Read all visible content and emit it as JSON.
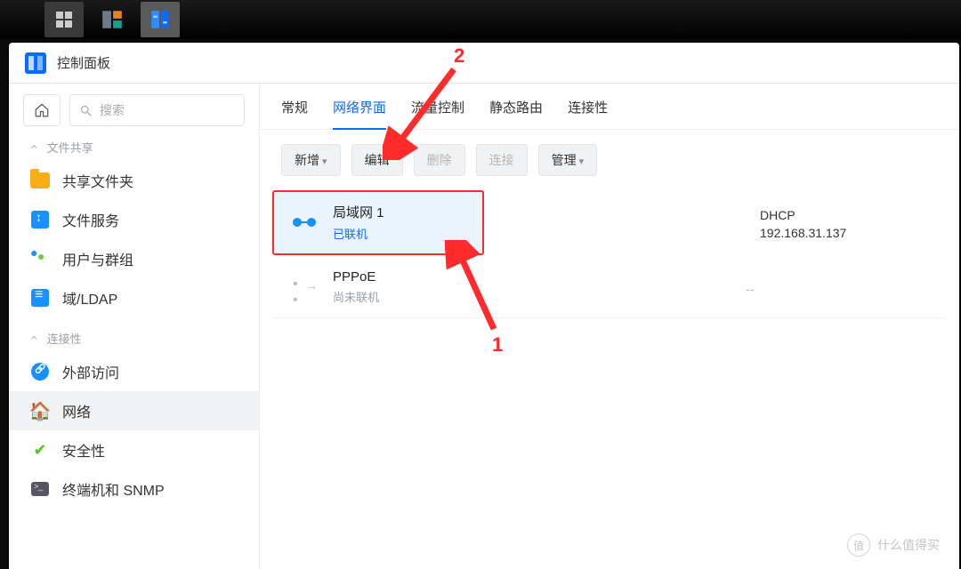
{
  "taskbar": {
    "apps_label": "Applications"
  },
  "window": {
    "title": "控制面板"
  },
  "sidebar": {
    "search_placeholder": "搜索",
    "sections": {
      "file_share": "文件共享",
      "connectivity": "连接性"
    },
    "items": {
      "shared_folder": "共享文件夹",
      "file_services": "文件服务",
      "users_groups": "用户与群组",
      "domain_ldap": "域/LDAP",
      "external_access": "外部访问",
      "network": "网络",
      "security": "安全性",
      "terminal_snmp": "终端机和 SNMP"
    }
  },
  "tabs": {
    "general": "常规",
    "network_interface": "网络界面",
    "traffic": "流量控制",
    "static_route": "静态路由",
    "connectivity": "连接性"
  },
  "toolbar": {
    "add": "新增",
    "edit": "编辑",
    "delete": "删除",
    "connect": "连接",
    "manage": "管理"
  },
  "interfaces": [
    {
      "name": "局域网 1",
      "status": "已联机",
      "type": "DHCP",
      "ip": "192.168.31.137",
      "connected": true
    },
    {
      "name": "PPPoE",
      "status": "尚未联机",
      "type": "",
      "ip": "--",
      "connected": false
    }
  ],
  "annotations": {
    "label1": "1",
    "label2": "2"
  },
  "watermark": {
    "badge": "值",
    "text": "什么值得买"
  }
}
